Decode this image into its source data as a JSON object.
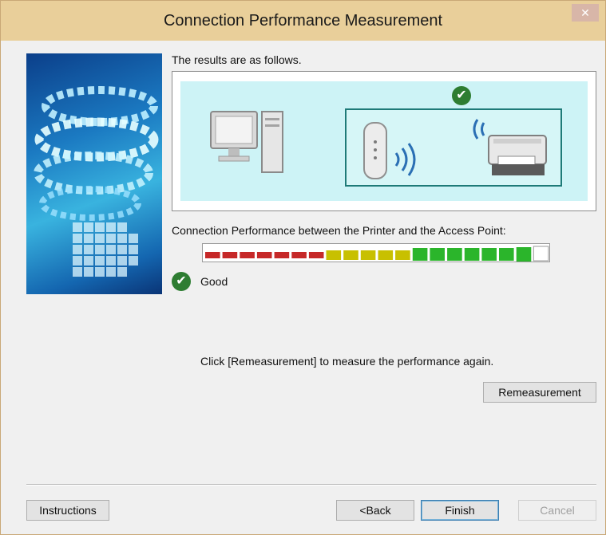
{
  "window": {
    "title": "Connection Performance Measurement",
    "close_glyph": "✕"
  },
  "results": {
    "label": "The results are as follows.",
    "check_glyph": "✔"
  },
  "performance": {
    "label": "Connection Performance between the Printer and the Access Point:",
    "level": 0.95,
    "segments_total": 20,
    "segments_filled": 19,
    "colors": {
      "low": "#c62828",
      "mid": "#c8c000",
      "high": "#2bb52b",
      "empty": "#ffffff"
    },
    "status_text": "Good",
    "status_icon": "check-circle-icon"
  },
  "hint": {
    "text": "Click [Remeasurement] to measure the performance again."
  },
  "buttons": {
    "remeasurement": "Remeasurement",
    "instructions": "Instructions",
    "back": "<Back",
    "finish": "Finish",
    "cancel": "Cancel"
  }
}
